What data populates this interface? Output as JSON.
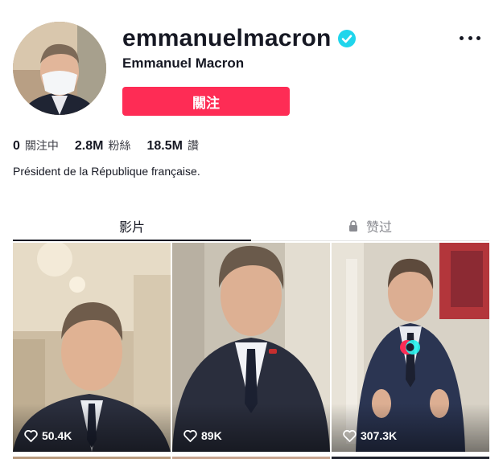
{
  "profile": {
    "username": "emmanuelmacron",
    "nickname": "Emmanuel Macron",
    "follow_label": "關注",
    "bio": "Président de la République française.",
    "verified": true
  },
  "stats": [
    {
      "value": "0",
      "label": "關注中"
    },
    {
      "value": "2.8M",
      "label": "粉絲"
    },
    {
      "value": "18.5M",
      "label": "讚"
    }
  ],
  "tabs": [
    {
      "label": "影片",
      "active": true
    },
    {
      "label": "赞过",
      "active": false,
      "icon": "lock-icon"
    }
  ],
  "videos": [
    {
      "likes": "50.4K"
    },
    {
      "likes": "89K"
    },
    {
      "likes": "307.3K"
    }
  ],
  "colors": {
    "accent": "#fe2c55",
    "verified": "#20d5ec",
    "text": "#161823"
  }
}
